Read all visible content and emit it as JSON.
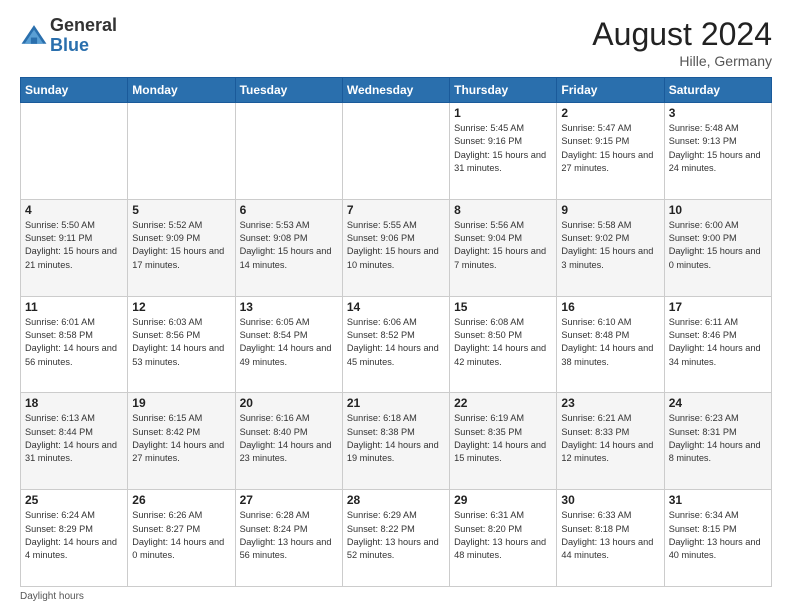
{
  "logo": {
    "general": "General",
    "blue": "Blue"
  },
  "header": {
    "month_year": "August 2024",
    "location": "Hille, Germany"
  },
  "days_of_week": [
    "Sunday",
    "Monday",
    "Tuesday",
    "Wednesday",
    "Thursday",
    "Friday",
    "Saturday"
  ],
  "footer": {
    "note": "Daylight hours"
  },
  "weeks": [
    [
      {
        "day": "",
        "sunrise": "",
        "sunset": "",
        "daylight": ""
      },
      {
        "day": "",
        "sunrise": "",
        "sunset": "",
        "daylight": ""
      },
      {
        "day": "",
        "sunrise": "",
        "sunset": "",
        "daylight": ""
      },
      {
        "day": "",
        "sunrise": "",
        "sunset": "",
        "daylight": ""
      },
      {
        "day": "1",
        "sunrise": "Sunrise: 5:45 AM",
        "sunset": "Sunset: 9:16 PM",
        "daylight": "Daylight: 15 hours and 31 minutes."
      },
      {
        "day": "2",
        "sunrise": "Sunrise: 5:47 AM",
        "sunset": "Sunset: 9:15 PM",
        "daylight": "Daylight: 15 hours and 27 minutes."
      },
      {
        "day": "3",
        "sunrise": "Sunrise: 5:48 AM",
        "sunset": "Sunset: 9:13 PM",
        "daylight": "Daylight: 15 hours and 24 minutes."
      }
    ],
    [
      {
        "day": "4",
        "sunrise": "Sunrise: 5:50 AM",
        "sunset": "Sunset: 9:11 PM",
        "daylight": "Daylight: 15 hours and 21 minutes."
      },
      {
        "day": "5",
        "sunrise": "Sunrise: 5:52 AM",
        "sunset": "Sunset: 9:09 PM",
        "daylight": "Daylight: 15 hours and 17 minutes."
      },
      {
        "day": "6",
        "sunrise": "Sunrise: 5:53 AM",
        "sunset": "Sunset: 9:08 PM",
        "daylight": "Daylight: 15 hours and 14 minutes."
      },
      {
        "day": "7",
        "sunrise": "Sunrise: 5:55 AM",
        "sunset": "Sunset: 9:06 PM",
        "daylight": "Daylight: 15 hours and 10 minutes."
      },
      {
        "day": "8",
        "sunrise": "Sunrise: 5:56 AM",
        "sunset": "Sunset: 9:04 PM",
        "daylight": "Daylight: 15 hours and 7 minutes."
      },
      {
        "day": "9",
        "sunrise": "Sunrise: 5:58 AM",
        "sunset": "Sunset: 9:02 PM",
        "daylight": "Daylight: 15 hours and 3 minutes."
      },
      {
        "day": "10",
        "sunrise": "Sunrise: 6:00 AM",
        "sunset": "Sunset: 9:00 PM",
        "daylight": "Daylight: 15 hours and 0 minutes."
      }
    ],
    [
      {
        "day": "11",
        "sunrise": "Sunrise: 6:01 AM",
        "sunset": "Sunset: 8:58 PM",
        "daylight": "Daylight: 14 hours and 56 minutes."
      },
      {
        "day": "12",
        "sunrise": "Sunrise: 6:03 AM",
        "sunset": "Sunset: 8:56 PM",
        "daylight": "Daylight: 14 hours and 53 minutes."
      },
      {
        "day": "13",
        "sunrise": "Sunrise: 6:05 AM",
        "sunset": "Sunset: 8:54 PM",
        "daylight": "Daylight: 14 hours and 49 minutes."
      },
      {
        "day": "14",
        "sunrise": "Sunrise: 6:06 AM",
        "sunset": "Sunset: 8:52 PM",
        "daylight": "Daylight: 14 hours and 45 minutes."
      },
      {
        "day": "15",
        "sunrise": "Sunrise: 6:08 AM",
        "sunset": "Sunset: 8:50 PM",
        "daylight": "Daylight: 14 hours and 42 minutes."
      },
      {
        "day": "16",
        "sunrise": "Sunrise: 6:10 AM",
        "sunset": "Sunset: 8:48 PM",
        "daylight": "Daylight: 14 hours and 38 minutes."
      },
      {
        "day": "17",
        "sunrise": "Sunrise: 6:11 AM",
        "sunset": "Sunset: 8:46 PM",
        "daylight": "Daylight: 14 hours and 34 minutes."
      }
    ],
    [
      {
        "day": "18",
        "sunrise": "Sunrise: 6:13 AM",
        "sunset": "Sunset: 8:44 PM",
        "daylight": "Daylight: 14 hours and 31 minutes."
      },
      {
        "day": "19",
        "sunrise": "Sunrise: 6:15 AM",
        "sunset": "Sunset: 8:42 PM",
        "daylight": "Daylight: 14 hours and 27 minutes."
      },
      {
        "day": "20",
        "sunrise": "Sunrise: 6:16 AM",
        "sunset": "Sunset: 8:40 PM",
        "daylight": "Daylight: 14 hours and 23 minutes."
      },
      {
        "day": "21",
        "sunrise": "Sunrise: 6:18 AM",
        "sunset": "Sunset: 8:38 PM",
        "daylight": "Daylight: 14 hours and 19 minutes."
      },
      {
        "day": "22",
        "sunrise": "Sunrise: 6:19 AM",
        "sunset": "Sunset: 8:35 PM",
        "daylight": "Daylight: 14 hours and 15 minutes."
      },
      {
        "day": "23",
        "sunrise": "Sunrise: 6:21 AM",
        "sunset": "Sunset: 8:33 PM",
        "daylight": "Daylight: 14 hours and 12 minutes."
      },
      {
        "day": "24",
        "sunrise": "Sunrise: 6:23 AM",
        "sunset": "Sunset: 8:31 PM",
        "daylight": "Daylight: 14 hours and 8 minutes."
      }
    ],
    [
      {
        "day": "25",
        "sunrise": "Sunrise: 6:24 AM",
        "sunset": "Sunset: 8:29 PM",
        "daylight": "Daylight: 14 hours and 4 minutes."
      },
      {
        "day": "26",
        "sunrise": "Sunrise: 6:26 AM",
        "sunset": "Sunset: 8:27 PM",
        "daylight": "Daylight: 14 hours and 0 minutes."
      },
      {
        "day": "27",
        "sunrise": "Sunrise: 6:28 AM",
        "sunset": "Sunset: 8:24 PM",
        "daylight": "Daylight: 13 hours and 56 minutes."
      },
      {
        "day": "28",
        "sunrise": "Sunrise: 6:29 AM",
        "sunset": "Sunset: 8:22 PM",
        "daylight": "Daylight: 13 hours and 52 minutes."
      },
      {
        "day": "29",
        "sunrise": "Sunrise: 6:31 AM",
        "sunset": "Sunset: 8:20 PM",
        "daylight": "Daylight: 13 hours and 48 minutes."
      },
      {
        "day": "30",
        "sunrise": "Sunrise: 6:33 AM",
        "sunset": "Sunset: 8:18 PM",
        "daylight": "Daylight: 13 hours and 44 minutes."
      },
      {
        "day": "31",
        "sunrise": "Sunrise: 6:34 AM",
        "sunset": "Sunset: 8:15 PM",
        "daylight": "Daylight: 13 hours and 40 minutes."
      }
    ]
  ]
}
